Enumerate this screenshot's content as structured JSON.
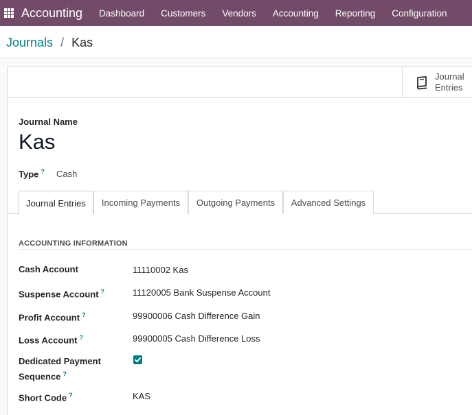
{
  "navbar": {
    "app_name": "Accounting",
    "menu": [
      "Dashboard",
      "Customers",
      "Vendors",
      "Accounting",
      "Reporting",
      "Configuration"
    ]
  },
  "breadcrumb": {
    "parent": "Journals",
    "separator": "/",
    "current": "Kas"
  },
  "stat_button": {
    "line1": "Journal",
    "line2": "Entries",
    "icon": "book-icon"
  },
  "form": {
    "journal_name_label": "Journal Name",
    "journal_name": "Kas",
    "type_label": "Type",
    "type_value": "Cash",
    "help_mark": "?"
  },
  "tabs": [
    "Journal Entries",
    "Incoming Payments",
    "Outgoing Payments",
    "Advanced Settings"
  ],
  "active_tab": "Journal Entries",
  "section": {
    "title": "ACCOUNTING INFORMATION",
    "fields": [
      {
        "label": "Cash Account",
        "value": "11110002 Kas",
        "help": false
      },
      {
        "label": "Suspense Account",
        "value": "11120005 Bank Suspense Account",
        "help": true
      },
      {
        "label": "Profit Account",
        "value": "99900006 Cash Difference Gain",
        "help": true
      },
      {
        "label": "Loss Account",
        "value": "99900005 Cash Difference Loss",
        "help": true
      },
      {
        "label_line1": "Dedicated Payment",
        "label_line2": "Sequence",
        "value": true,
        "help": true
      },
      {
        "label": "Short Code",
        "value": "KAS",
        "help": true
      }
    ]
  },
  "colors": {
    "navbar": "#714b67",
    "link": "#017e84",
    "checkbox": "#017e84"
  }
}
